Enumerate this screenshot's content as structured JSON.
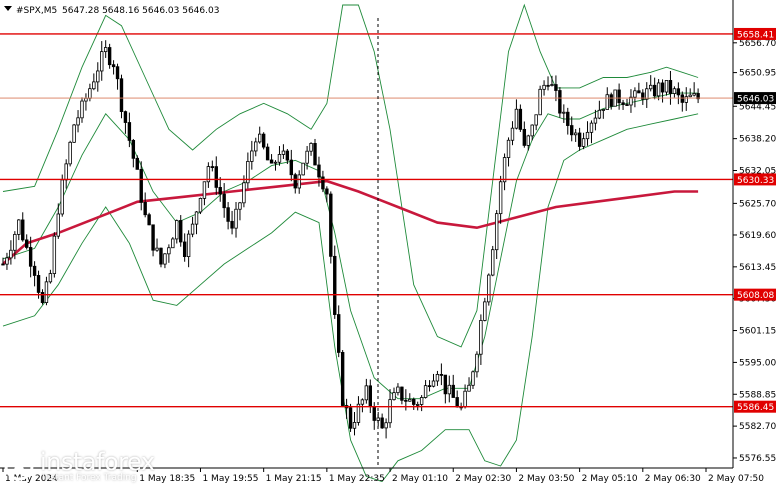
{
  "header": {
    "symbol_tf": "#SPX,M5",
    "ohlc": "5647.28 5648.16 5646.03 5646.03"
  },
  "colors": {
    "candle": "#000000",
    "bollinger": "#1f8a3a",
    "moving_average": "#c8183c",
    "level_line": "#e00000",
    "price_line": "#d87a5a",
    "axis": "#000000"
  },
  "watermark": {
    "name": "instaforex",
    "tagline": "Instant Forex Trading",
    "icon": "instaforex-logo-icon"
  },
  "chart_data": {
    "type": "candlestick",
    "title": "",
    "xlabel": "",
    "ylabel": "",
    "ylim": [
      5575.0,
      5664.0
    ],
    "y_ticks": [
      5656.7,
      5650.95,
      5644.45,
      5638.2,
      5632.05,
      5625.7,
      5619.6,
      5613.45,
      5607.3,
      5601.15,
      5595.0,
      5588.85,
      5582.7,
      5576.55
    ],
    "x_ticks": [
      {
        "label": "1 May 2024",
        "t": 0
      },
      {
        "label": "1 May 18:35",
        "t": 34
      },
      {
        "label": "1 May 19:55",
        "t": 50
      },
      {
        "label": "1 May 21:15",
        "t": 66
      },
      {
        "label": "1 May 22:35",
        "t": 82
      },
      {
        "label": "2 May 01:10",
        "t": 98
      },
      {
        "label": "2 May 02:30",
        "t": 114
      },
      {
        "label": "2 May 03:50",
        "t": 130
      },
      {
        "label": "2 May 05:10",
        "t": 146
      },
      {
        "label": "2 May 06:30",
        "t": 162
      },
      {
        "label": "2 May 07:50",
        "t": 178
      }
    ],
    "levels": [
      {
        "label": "5658.41",
        "value": 5658.41
      },
      {
        "label": "5630.33",
        "value": 5630.33
      },
      {
        "label": "5608.08",
        "value": 5608.08
      },
      {
        "label": "5586.45",
        "value": 5586.45
      }
    ],
    "current_price": {
      "label": "5646.03",
      "value": 5646.03
    },
    "series": [
      {
        "type": "ohlc",
        "close_path": [
          [
            0,
            5614
          ],
          [
            2,
            5618
          ],
          [
            4,
            5622
          ],
          [
            6,
            5617
          ],
          [
            8,
            5613
          ],
          [
            10,
            5606
          ],
          [
            12,
            5612
          ],
          [
            14,
            5625
          ],
          [
            16,
            5633
          ],
          [
            18,
            5641
          ],
          [
            20,
            5644
          ],
          [
            22,
            5648
          ],
          [
            24,
            5652
          ],
          [
            26,
            5655
          ],
          [
            28,
            5653
          ],
          [
            30,
            5645
          ],
          [
            32,
            5638
          ],
          [
            34,
            5631
          ],
          [
            36,
            5623
          ],
          [
            38,
            5618
          ],
          [
            40,
            5614
          ],
          [
            42,
            5618
          ],
          [
            44,
            5622
          ],
          [
            46,
            5617
          ],
          [
            48,
            5621
          ],
          [
            50,
            5628
          ],
          [
            52,
            5633
          ],
          [
            54,
            5630
          ],
          [
            56,
            5625
          ],
          [
            58,
            5620
          ],
          [
            60,
            5626
          ],
          [
            62,
            5633
          ],
          [
            64,
            5639
          ],
          [
            66,
            5636
          ],
          [
            68,
            5632
          ],
          [
            70,
            5636
          ],
          [
            72,
            5633
          ],
          [
            74,
            5630
          ],
          [
            76,
            5634
          ],
          [
            78,
            5636
          ],
          [
            80,
            5632
          ],
          [
            82,
            5628
          ],
          [
            84,
            5603
          ],
          [
            86,
            5588
          ],
          [
            88,
            5583
          ],
          [
            90,
            5586
          ],
          [
            92,
            5589
          ],
          [
            94,
            5585
          ],
          [
            96,
            5582
          ],
          [
            98,
            5587
          ],
          [
            100,
            5589
          ],
          [
            102,
            5588
          ],
          [
            104,
            5587
          ],
          [
            106,
            5588
          ],
          [
            108,
            5592
          ],
          [
            110,
            5594
          ],
          [
            112,
            5590
          ],
          [
            114,
            5588
          ],
          [
            116,
            5586
          ],
          [
            118,
            5590
          ],
          [
            120,
            5598
          ],
          [
            122,
            5608
          ],
          [
            124,
            5618
          ],
          [
            126,
            5630
          ],
          [
            128,
            5638
          ],
          [
            130,
            5644
          ],
          [
            132,
            5636
          ],
          [
            134,
            5640
          ],
          [
            136,
            5647
          ],
          [
            138,
            5650
          ],
          [
            140,
            5646
          ],
          [
            142,
            5642
          ],
          [
            144,
            5640
          ],
          [
            146,
            5638
          ],
          [
            148,
            5641
          ],
          [
            150,
            5643
          ],
          [
            152,
            5645
          ],
          [
            154,
            5646
          ],
          [
            156,
            5646
          ],
          [
            158,
            5646
          ],
          [
            160,
            5646
          ],
          [
            162,
            5647
          ],
          [
            164,
            5647
          ],
          [
            166,
            5648
          ],
          [
            168,
            5648
          ],
          [
            170,
            5647
          ],
          [
            172,
            5645
          ],
          [
            174,
            5646
          ],
          [
            176,
            5646
          ]
        ]
      },
      {
        "type": "moving_average",
        "points": [
          [
            0,
            5614
          ],
          [
            6,
            5618
          ],
          [
            14,
            5620
          ],
          [
            24,
            5623
          ],
          [
            34,
            5626
          ],
          [
            46,
            5627
          ],
          [
            58,
            5628
          ],
          [
            70,
            5629
          ],
          [
            82,
            5630
          ],
          [
            90,
            5628
          ],
          [
            100,
            5625
          ],
          [
            110,
            5622
          ],
          [
            120,
            5621
          ],
          [
            130,
            5623
          ],
          [
            140,
            5625
          ],
          [
            150,
            5626
          ],
          [
            160,
            5627
          ],
          [
            170,
            5628
          ],
          [
            176,
            5628
          ]
        ]
      },
      {
        "type": "bollinger_upper",
        "points": [
          [
            0,
            5628
          ],
          [
            8,
            5629
          ],
          [
            14,
            5640
          ],
          [
            20,
            5652
          ],
          [
            26,
            5662
          ],
          [
            30,
            5660
          ],
          [
            36,
            5650
          ],
          [
            42,
            5640
          ],
          [
            48,
            5636
          ],
          [
            54,
            5640
          ],
          [
            60,
            5643
          ],
          [
            66,
            5645
          ],
          [
            72,
            5643
          ],
          [
            78,
            5640
          ],
          [
            82,
            5645
          ],
          [
            86,
            5664
          ],
          [
            90,
            5664
          ],
          [
            94,
            5655
          ],
          [
            98,
            5640
          ],
          [
            104,
            5610
          ],
          [
            110,
            5600
          ],
          [
            116,
            5598
          ],
          [
            120,
            5605
          ],
          [
            124,
            5630
          ],
          [
            128,
            5655
          ],
          [
            132,
            5664
          ],
          [
            136,
            5655
          ],
          [
            140,
            5648
          ],
          [
            146,
            5648
          ],
          [
            152,
            5650
          ],
          [
            158,
            5650
          ],
          [
            164,
            5651
          ],
          [
            168,
            5652
          ],
          [
            172,
            5651
          ],
          [
            176,
            5650
          ]
        ]
      },
      {
        "type": "bollinger_middle",
        "points": [
          [
            0,
            5615
          ],
          [
            8,
            5617
          ],
          [
            14,
            5625
          ],
          [
            20,
            5635
          ],
          [
            26,
            5643
          ],
          [
            32,
            5638
          ],
          [
            38,
            5628
          ],
          [
            44,
            5622
          ],
          [
            50,
            5624
          ],
          [
            56,
            5628
          ],
          [
            62,
            5630
          ],
          [
            68,
            5633
          ],
          [
            74,
            5634
          ],
          [
            80,
            5632
          ],
          [
            84,
            5620
          ],
          [
            88,
            5605
          ],
          [
            94,
            5592
          ],
          [
            100,
            5588
          ],
          [
            106,
            5588
          ],
          [
            112,
            5590
          ],
          [
            118,
            5590
          ],
          [
            122,
            5600
          ],
          [
            126,
            5615
          ],
          [
            130,
            5630
          ],
          [
            134,
            5638
          ],
          [
            138,
            5643
          ],
          [
            142,
            5642
          ],
          [
            146,
            5642
          ],
          [
            152,
            5644
          ],
          [
            158,
            5645
          ],
          [
            164,
            5646
          ],
          [
            170,
            5647
          ],
          [
            176,
            5647
          ]
        ]
      },
      {
        "type": "bollinger_lower",
        "points": [
          [
            0,
            5602
          ],
          [
            8,
            5604
          ],
          [
            14,
            5610
          ],
          [
            20,
            5618
          ],
          [
            26,
            5625
          ],
          [
            32,
            5618
          ],
          [
            38,
            5607
          ],
          [
            44,
            5606
          ],
          [
            50,
            5610
          ],
          [
            56,
            5614
          ],
          [
            62,
            5617
          ],
          [
            68,
            5620
          ],
          [
            74,
            5624
          ],
          [
            80,
            5622
          ],
          [
            84,
            5598
          ],
          [
            88,
            5580
          ],
          [
            92,
            5573
          ],
          [
            96,
            5572
          ],
          [
            100,
            5576
          ],
          [
            106,
            5578
          ],
          [
            112,
            5582
          ],
          [
            118,
            5582
          ],
          [
            122,
            5576
          ],
          [
            126,
            5575
          ],
          [
            130,
            5580
          ],
          [
            134,
            5600
          ],
          [
            138,
            5625
          ],
          [
            142,
            5634
          ],
          [
            146,
            5636
          ],
          [
            152,
            5638
          ],
          [
            158,
            5640
          ],
          [
            164,
            5641
          ],
          [
            170,
            5642
          ],
          [
            176,
            5643
          ]
        ]
      }
    ]
  }
}
